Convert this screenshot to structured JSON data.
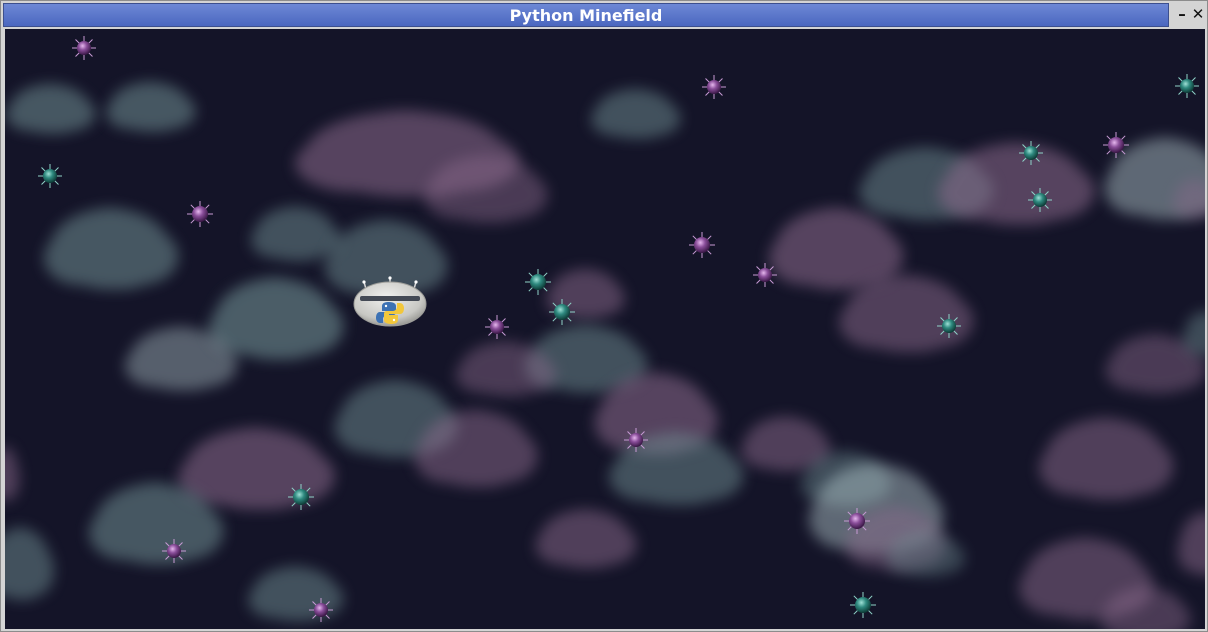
{
  "window": {
    "title": "Python Minefield",
    "minimize_label": "–",
    "close_label": "✕"
  },
  "game": {
    "background_color": "#141428",
    "cloud_colors": {
      "teal": "#6f8e92",
      "pink": "#8c6a8c",
      "light": "#b9cfd2"
    },
    "mine_colors": {
      "teal": "#2f8a80",
      "purple": "#8a4e9a"
    },
    "player": {
      "icon": "python-logo-icon",
      "ship": "flying-saucer"
    }
  }
}
